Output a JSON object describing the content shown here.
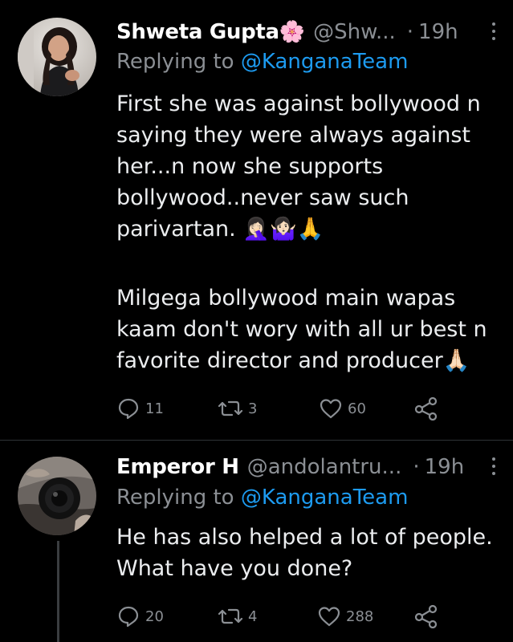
{
  "tweets": [
    {
      "author_name": "Shweta Gupta",
      "author_emoji": "🌸",
      "handle": "@Shw...",
      "separator": "·",
      "time": "19h",
      "replying_prefix": "Replying to",
      "replying_to": "@KanganaTeam",
      "text_1": "First she was against bollywood n\nsaying they were always against\nher...n now she supports\nbollywood..never saw such\nparivartan. 🤦🏻‍♀️🤷🏻‍♀️🙏",
      "text_2": "Milgega bollywood main wapas\nkaam don't wory with all ur best n\nfavorite director and producer🙏🏻",
      "replies": "11",
      "retweets": "3",
      "likes": "60"
    },
    {
      "author_name": "Emperor H",
      "handle": "@andolantru...",
      "separator": "·",
      "time": "19h",
      "replying_prefix": "Replying to",
      "replying_to": "@KanganaTeam",
      "text": "He has also helped a lot of people.\nWhat have you done?",
      "replies": "20",
      "retweets": "4",
      "likes": "288"
    }
  ],
  "icons": {
    "reply": "reply-icon",
    "retweet": "retweet-icon",
    "like": "heart-icon",
    "share": "share-icon",
    "more": "more-options-icon"
  },
  "colors": {
    "background": "#000000",
    "muted": "#8b8f94",
    "mention": "#1d9bf0",
    "text": "#e7e9ea"
  }
}
